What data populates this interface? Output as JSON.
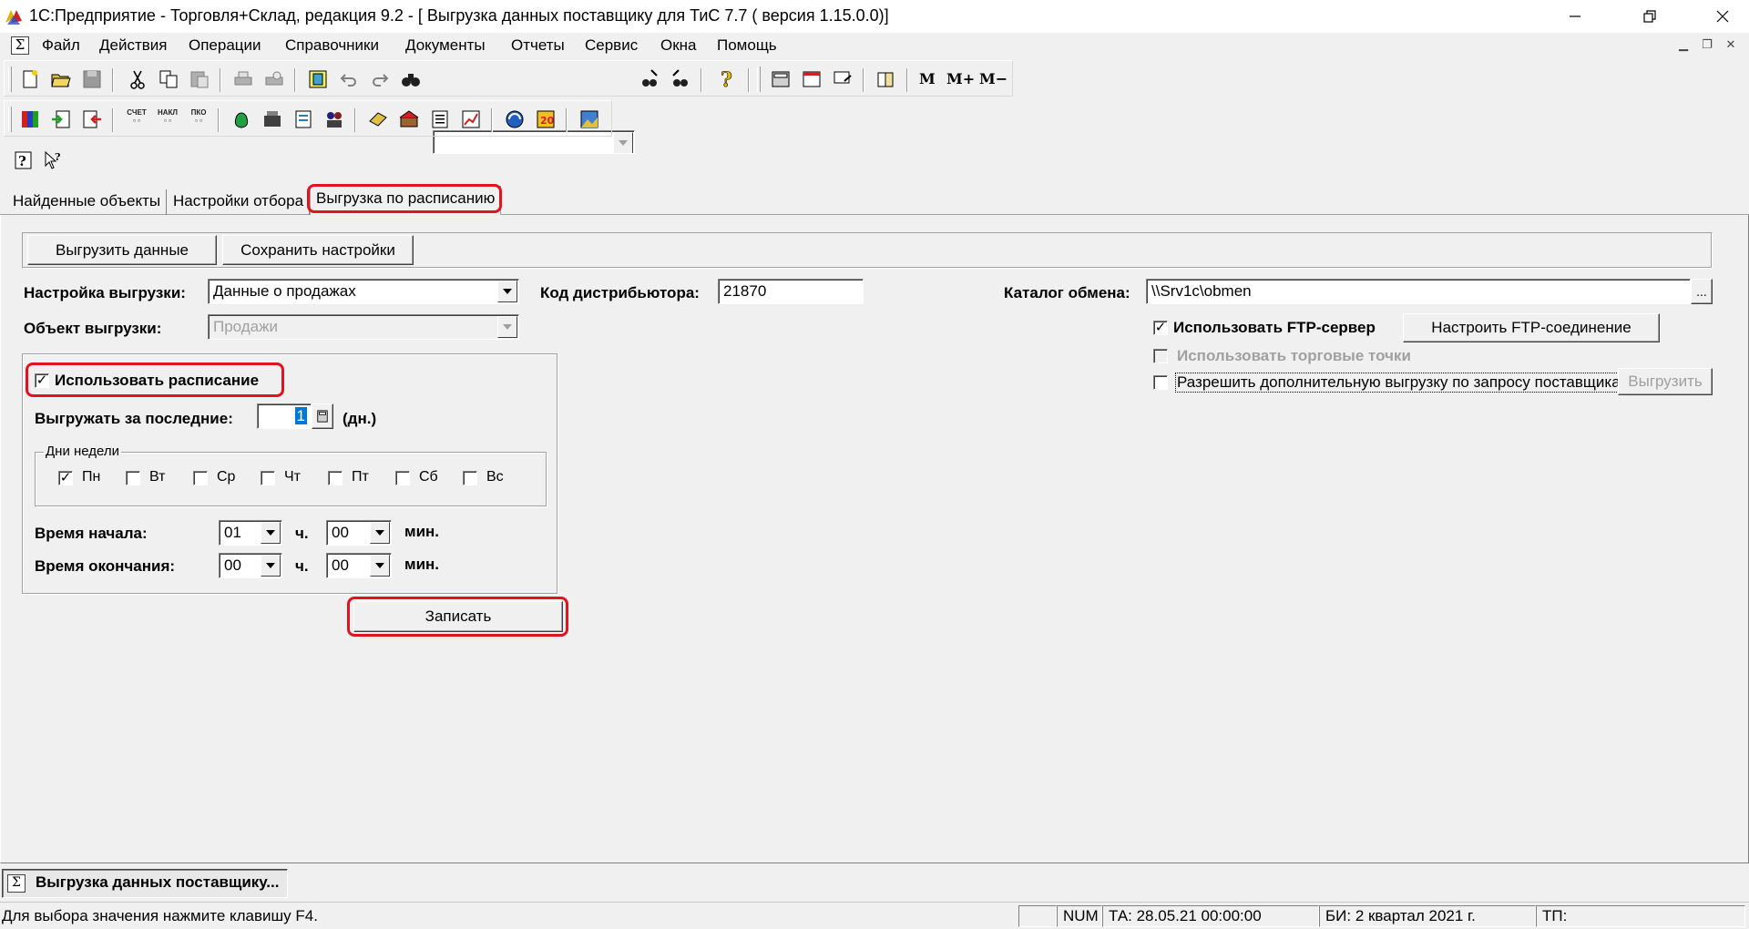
{
  "window": {
    "title": "1С:Предприятие - Торговля+Склад, редакция 9.2 - [ Выгрузка данных поставщику для ТиС 7.7 ( версия 1.15.0.0)]"
  },
  "menu": {
    "items": [
      {
        "label": "Файл",
        "name": "menu-file"
      },
      {
        "label": "Действия",
        "name": "menu-actions"
      },
      {
        "label": "Операции",
        "name": "menu-operations"
      },
      {
        "label": "Справочники",
        "name": "menu-catalogs"
      },
      {
        "label": "Документы",
        "name": "menu-documents"
      },
      {
        "label": "Отчеты",
        "name": "menu-reports"
      },
      {
        "label": "Сервис",
        "name": "menu-service"
      },
      {
        "label": "Окна",
        "name": "menu-windows"
      },
      {
        "label": "Помощь",
        "name": "menu-help"
      }
    ]
  },
  "toolbar": {
    "m": "M",
    "m_plus": "M+",
    "m_minus": "M−",
    "mini_labels": [
      "СЧЕТ",
      "НАКЛ",
      "ПКО"
    ]
  },
  "tabs": [
    {
      "label": "Найденные объекты",
      "active": false
    },
    {
      "label": "Настройки отбора",
      "active": false
    },
    {
      "label": "Выгрузка по расписанию",
      "active": true
    }
  ],
  "form": {
    "btn_upload": "Выгрузить данные",
    "btn_save_settings": "Сохранить настройки",
    "export_setting_label": "Настройка выгрузки:",
    "export_setting_value": "Данные о продажах",
    "distributor_code_label": "Код дистрибьютора:",
    "distributor_code_value": "21870",
    "exchange_dir_label": "Каталог обмена:",
    "exchange_dir_value": "\\\\Srv1c\\obmen",
    "browse_btn": "...",
    "export_object_label": "Объект выгрузки:",
    "export_object_value": "Продажи",
    "use_ftp_label": "Использовать FTP-сервер",
    "use_ftp_checked": true,
    "ftp_settings_btn": "Настроить FTP-соединение",
    "use_trade_points_label": "Использовать торговые точки",
    "use_trade_points_checked": false,
    "allow_extra_label": "Разрешить дополнительную выгрузку по запросу поставщика",
    "allow_extra_checked": false,
    "extra_upload_btn": "Выгрузить",
    "use_schedule_label": "Использовать расписание",
    "use_schedule_checked": true,
    "upload_last_label": "Выгружать за последние:",
    "upload_last_value": "1",
    "upload_last_unit": "(дн.)",
    "weekdays_title": "Дни недели",
    "weekdays": [
      {
        "label": "Пн",
        "checked": true
      },
      {
        "label": "Вт",
        "checked": false
      },
      {
        "label": "Ср",
        "checked": false
      },
      {
        "label": "Чт",
        "checked": false
      },
      {
        "label": "Пт",
        "checked": false
      },
      {
        "label": "Сб",
        "checked": false
      },
      {
        "label": "Вс",
        "checked": false
      }
    ],
    "start_time_label": "Время начала:",
    "start_hour": "01",
    "start_minute": "00",
    "end_time_label": "Время окончания:",
    "end_hour": "00",
    "end_minute": "00",
    "hour_unit": "ч.",
    "minute_unit": "мин.",
    "write_btn": "Записать"
  },
  "taskbar": {
    "window_button": "Выгрузка данных поставщику..."
  },
  "statusbar": {
    "hint": "Для выбора значения нажмите клавишу F4.",
    "num": "NUM",
    "ta": "ТА: 28.05.21  00:00:00",
    "bi": "БИ: 2 квартал 2021 г.",
    "tp": "ТП:"
  },
  "colors": {
    "highlight": "#e0141e",
    "background": "#f0f0f0"
  }
}
